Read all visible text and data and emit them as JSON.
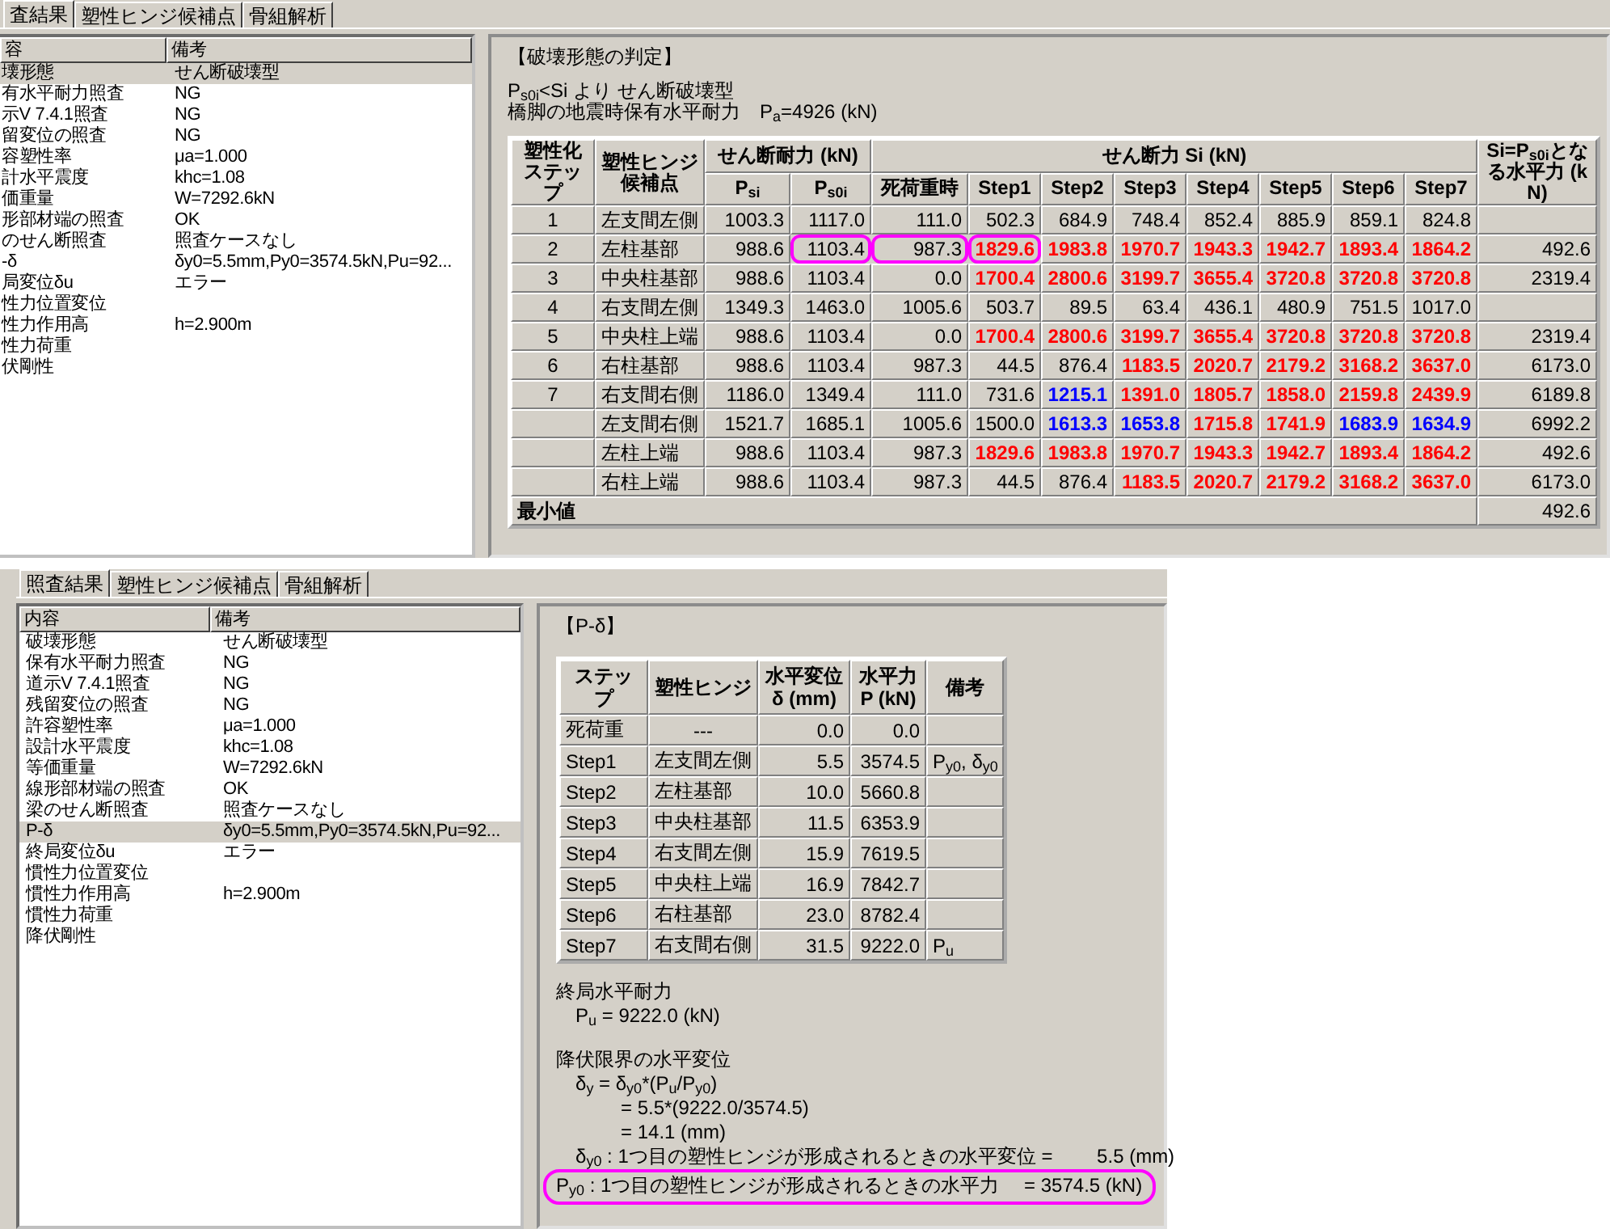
{
  "upper_window": {
    "tabs": [
      {
        "label": "査結果",
        "selected": true
      },
      {
        "label": "塑性ヒンジ候補点",
        "selected": false
      },
      {
        "label": "骨組解析",
        "selected": false
      }
    ],
    "list": {
      "columns": [
        "容",
        "備考"
      ],
      "rows": [
        {
          "label": "壊形態",
          "note": "せん断破壊型",
          "selected": true
        },
        {
          "label": "有水平耐力照査",
          "note": "NG",
          "selected": false
        },
        {
          "label": "示V 7.4.1照査",
          "note": "NG",
          "selected": false
        },
        {
          "label": "留変位の照査",
          "note": "NG",
          "selected": false
        },
        {
          "label": "容塑性率",
          "note": "μa=1.000",
          "selected": false
        },
        {
          "label": "計水平震度",
          "note": "khc=1.08",
          "selected": false
        },
        {
          "label": "価重量",
          "note": "W=7292.6kN",
          "selected": false
        },
        {
          "label": "形部材端の照査",
          "note": "OK",
          "selected": false
        },
        {
          "label": "のせん断照査",
          "note": "照査ケースなし",
          "selected": false
        },
        {
          "label": "-δ",
          "note": "δy0=5.5mm,Py0=3574.5kN,Pu=92...",
          "selected": false
        },
        {
          "label": "局変位δu",
          "note": "エラー",
          "selected": false
        },
        {
          "label": "性力位置変位",
          "selected": false
        },
        {
          "label": "性力作用高",
          "note": "h=2.900m",
          "selected": false
        },
        {
          "label": "性力荷重",
          "selected": false
        },
        {
          "label": "伏剛性",
          "selected": false
        }
      ]
    },
    "panel": {
      "heading": "【破壊形態の判定】",
      "lines": [
        "P$_{s0i}$<Si より せん断破壊型",
        "橋脚の地震時保有水平耐力　P$_{a}$=4926 (kN)"
      ],
      "table": {
        "headers": {
          "step": "塑性化ステップ",
          "hinge": "塑性ヒンジ候補点",
          "capacity": "せん断耐力 (kN)",
          "psi": "P$_{si}$",
          "ps0i": "P$_{s0i}$",
          "force": "せん断力 Si (kN)",
          "force_columns": [
            "死荷重時",
            "Step1",
            "Step2",
            "Step3",
            "Step4",
            "Step5",
            "Step6",
            "Step7"
          ],
          "result": "Si=P$_{s0i}$となる水平力 (kN)"
        },
        "rows": [
          {
            "step": "1",
            "hinge": "左支間左側",
            "cells": [
              {
                "text": "1003.3",
                "kind": "plain",
                "circled": false
              },
              {
                "text": "1117.0",
                "kind": "plain",
                "circled": false
              },
              {
                "text": "111.0",
                "kind": "plain",
                "circled": false
              },
              {
                "text": "502.3",
                "kind": "plain",
                "circled": false
              },
              {
                "text": "684.9",
                "kind": "plain",
                "circled": false
              },
              {
                "text": "748.4",
                "kind": "plain",
                "circled": false
              },
              {
                "text": "852.4",
                "kind": "plain",
                "circled": false
              },
              {
                "text": "885.9",
                "kind": "plain",
                "circled": false
              },
              {
                "text": "859.1",
                "kind": "plain",
                "circled": false
              },
              {
                "text": "824.8",
                "kind": "plain",
                "circled": false
              }
            ]
          },
          {
            "step": "2",
            "hinge": "左柱基部",
            "result": "492.6",
            "cells": [
              {
                "text": "988.6",
                "kind": "plain",
                "circled": false
              },
              {
                "text": "1103.4",
                "kind": "plain",
                "circled": true
              },
              {
                "text": "987.3",
                "kind": "plain",
                "circled": true
              },
              {
                "text": "1829.6",
                "kind": "red",
                "circled": true
              },
              {
                "text": "1983.8",
                "kind": "red",
                "circled": false
              },
              {
                "text": "1970.7",
                "kind": "red",
                "circled": false
              },
              {
                "text": "1943.3",
                "kind": "red",
                "circled": false
              },
              {
                "text": "1942.7",
                "kind": "red",
                "circled": false
              },
              {
                "text": "1893.4",
                "kind": "red",
                "circled": false
              },
              {
                "text": "1864.2",
                "kind": "red",
                "circled": false
              }
            ]
          },
          {
            "step": "3",
            "hinge": "中央柱基部",
            "result": "2319.4",
            "cells": [
              {
                "text": "988.6",
                "kind": "plain",
                "circled": false
              },
              {
                "text": "1103.4",
                "kind": "plain",
                "circled": false
              },
              {
                "text": "0.0",
                "kind": "plain",
                "circled": false
              },
              {
                "text": "1700.4",
                "kind": "red",
                "circled": false
              },
              {
                "text": "2800.6",
                "kind": "red",
                "circled": false
              },
              {
                "text": "3199.7",
                "kind": "red",
                "circled": false
              },
              {
                "text": "3655.4",
                "kind": "red",
                "circled": false
              },
              {
                "text": "3720.8",
                "kind": "red",
                "circled": false
              },
              {
                "text": "3720.8",
                "kind": "red",
                "circled": false
              },
              {
                "text": "3720.8",
                "kind": "red",
                "circled": false
              }
            ]
          },
          {
            "step": "4",
            "hinge": "右支間左側",
            "cells": [
              {
                "text": "1349.3",
                "kind": "plain",
                "circled": false
              },
              {
                "text": "1463.0",
                "kind": "plain",
                "circled": false
              },
              {
                "text": "1005.6",
                "kind": "plain",
                "circled": false
              },
              {
                "text": "503.7",
                "kind": "plain",
                "circled": false
              },
              {
                "text": "89.5",
                "kind": "plain",
                "circled": false
              },
              {
                "text": "63.4",
                "kind": "plain",
                "circled": false
              },
              {
                "text": "436.1",
                "kind": "plain",
                "circled": false
              },
              {
                "text": "480.9",
                "kind": "plain",
                "circled": false
              },
              {
                "text": "751.5",
                "kind": "plain",
                "circled": false
              },
              {
                "text": "1017.0",
                "kind": "plain",
                "circled": false
              }
            ]
          },
          {
            "step": "5",
            "hinge": "中央柱上端",
            "result": "2319.4",
            "cells": [
              {
                "text": "988.6",
                "kind": "plain",
                "circled": false
              },
              {
                "text": "1103.4",
                "kind": "plain",
                "circled": false
              },
              {
                "text": "0.0",
                "kind": "plain",
                "circled": false
              },
              {
                "text": "1700.4",
                "kind": "red",
                "circled": false
              },
              {
                "text": "2800.6",
                "kind": "red",
                "circled": false
              },
              {
                "text": "3199.7",
                "kind": "red",
                "circled": false
              },
              {
                "text": "3655.4",
                "kind": "red",
                "circled": false
              },
              {
                "text": "3720.8",
                "kind": "red",
                "circled": false
              },
              {
                "text": "3720.8",
                "kind": "red",
                "circled": false
              },
              {
                "text": "3720.8",
                "kind": "red",
                "circled": false
              }
            ]
          },
          {
            "step": "6",
            "hinge": "右柱基部",
            "result": "6173.0",
            "cells": [
              {
                "text": "988.6",
                "kind": "plain",
                "circled": false
              },
              {
                "text": "1103.4",
                "kind": "plain",
                "circled": false
              },
              {
                "text": "987.3",
                "kind": "plain",
                "circled": false
              },
              {
                "text": "44.5",
                "kind": "plain",
                "circled": false
              },
              {
                "text": "876.4",
                "kind": "plain",
                "circled": false
              },
              {
                "text": "1183.5",
                "kind": "red",
                "circled": false
              },
              {
                "text": "2020.7",
                "kind": "red",
                "circled": false
              },
              {
                "text": "2179.2",
                "kind": "red",
                "circled": false
              },
              {
                "text": "3168.2",
                "kind": "red",
                "circled": false
              },
              {
                "text": "3637.0",
                "kind": "red",
                "circled": false
              }
            ]
          },
          {
            "step": "7",
            "hinge": "右支間右側",
            "result": "6189.8",
            "cells": [
              {
                "text": "1186.0",
                "kind": "plain",
                "circled": false
              },
              {
                "text": "1349.4",
                "kind": "plain",
                "circled": false
              },
              {
                "text": "111.0",
                "kind": "plain",
                "circled": false
              },
              {
                "text": "731.6",
                "kind": "plain",
                "circled": false
              },
              {
                "text": "1215.1",
                "kind": "blue",
                "circled": false
              },
              {
                "text": "1391.0",
                "kind": "red",
                "circled": false
              },
              {
                "text": "1805.7",
                "kind": "red",
                "circled": false
              },
              {
                "text": "1858.0",
                "kind": "red",
                "circled": false
              },
              {
                "text": "2159.8",
                "kind": "red",
                "circled": false
              },
              {
                "text": "2439.9",
                "kind": "red",
                "circled": false
              }
            ]
          },
          {
            "hinge": "左支間右側",
            "result": "6992.2",
            "cells": [
              {
                "text": "1521.7",
                "kind": "plain",
                "circled": false
              },
              {
                "text": "1685.1",
                "kind": "plain",
                "circled": false
              },
              {
                "text": "1005.6",
                "kind": "plain",
                "circled": false
              },
              {
                "text": "1500.0",
                "kind": "plain",
                "circled": false
              },
              {
                "text": "1613.3",
                "kind": "blue",
                "circled": false
              },
              {
                "text": "1653.8",
                "kind": "blue",
                "circled": false
              },
              {
                "text": "1715.8",
                "kind": "red",
                "circled": false
              },
              {
                "text": "1741.9",
                "kind": "red",
                "circled": false
              },
              {
                "text": "1683.9",
                "kind": "blue",
                "circled": false
              },
              {
                "text": "1634.9",
                "kind": "blue",
                "circled": false
              }
            ]
          },
          {
            "hinge": "左柱上端",
            "result": "492.6",
            "cells": [
              {
                "text": "988.6",
                "kind": "plain",
                "circled": false
              },
              {
                "text": "1103.4",
                "kind": "plain",
                "circled": false
              },
              {
                "text": "987.3",
                "kind": "plain",
                "circled": false
              },
              {
                "text": "1829.6",
                "kind": "red",
                "circled": false
              },
              {
                "text": "1983.8",
                "kind": "red",
                "circled": false
              },
              {
                "text": "1970.7",
                "kind": "red",
                "circled": false
              },
              {
                "text": "1943.3",
                "kind": "red",
                "circled": false
              },
              {
                "text": "1942.7",
                "kind": "red",
                "circled": false
              },
              {
                "text": "1893.4",
                "kind": "red",
                "circled": false
              },
              {
                "text": "1864.2",
                "kind": "red",
                "circled": false
              }
            ]
          },
          {
            "hinge": "右柱上端",
            "result": "6173.0",
            "cells": [
              {
                "text": "988.6",
                "kind": "plain",
                "circled": false
              },
              {
                "text": "1103.4",
                "kind": "plain",
                "circled": false
              },
              {
                "text": "987.3",
                "kind": "plain",
                "circled": false
              },
              {
                "text": "44.5",
                "kind": "plain",
                "circled": false
              },
              {
                "text": "876.4",
                "kind": "plain",
                "circled": false
              },
              {
                "text": "1183.5",
                "kind": "red",
                "circled": false
              },
              {
                "text": "2020.7",
                "kind": "red",
                "circled": false
              },
              {
                "text": "2179.2",
                "kind": "red",
                "circled": false
              },
              {
                "text": "3168.2",
                "kind": "red",
                "circled": false
              },
              {
                "text": "3637.0",
                "kind": "red",
                "circled": false
              }
            ]
          }
        ],
        "minimum": {
          "label": "最小値",
          "value": "492.6"
        }
      }
    }
  },
  "lower_window": {
    "tabs": [
      {
        "label": "照査結果",
        "selected": true
      },
      {
        "label": "塑性ヒンジ候補点",
        "selected": false
      },
      {
        "label": "骨組解析",
        "selected": false
      }
    ],
    "list": {
      "columns": [
        "内容",
        "備考"
      ],
      "rows": [
        {
          "label": "破壊形態",
          "note": "せん断破壊型",
          "selected": false
        },
        {
          "label": "保有水平耐力照査",
          "note": "NG",
          "selected": false
        },
        {
          "label": "道示V 7.4.1照査",
          "note": "NG",
          "selected": false
        },
        {
          "label": "残留変位の照査",
          "note": "NG",
          "selected": false
        },
        {
          "label": "許容塑性率",
          "note": "μa=1.000",
          "selected": false
        },
        {
          "label": "設計水平震度",
          "note": "khc=1.08",
          "selected": false
        },
        {
          "label": "等価重量",
          "note": "W=7292.6kN",
          "selected": false
        },
        {
          "label": "線形部材端の照査",
          "note": "OK",
          "selected": false
        },
        {
          "label": "梁のせん断照査",
          "note": "照査ケースなし",
          "selected": false
        },
        {
          "label": "P-δ",
          "note": "δy0=5.5mm,Py0=3574.5kN,Pu=92...",
          "selected": true
        },
        {
          "label": "終局変位δu",
          "note": "エラー",
          "selected": false
        },
        {
          "label": "慣性力位置変位",
          "selected": false
        },
        {
          "label": "慣性力作用高",
          "note": "h=2.900m",
          "selected": false
        },
        {
          "label": "慣性力荷重",
          "selected": false
        },
        {
          "label": "降伏剛性",
          "selected": false
        }
      ]
    },
    "panel": {
      "heading": "【P-δ】",
      "table": {
        "columns": [
          "ステップ",
          "塑性ヒンジ",
          "水平変位\nδ (mm)",
          "水平力\nP (kN)",
          "備考"
        ],
        "rows": [
          {
            "step": "死荷重",
            "hinge": "---",
            "displacement": "0.0",
            "force": "0.0"
          },
          {
            "step": "Step1",
            "hinge": "左支間左側",
            "displacement": "5.5",
            "force": "3574.5",
            "remark": "P$_{y0}$, δ$_{y0}$"
          },
          {
            "step": "Step2",
            "hinge": "左柱基部",
            "displacement": "10.0",
            "force": "5660.8"
          },
          {
            "step": "Step3",
            "hinge": "中央柱基部",
            "displacement": "11.5",
            "force": "6353.9"
          },
          {
            "step": "Step4",
            "hinge": "右支間左側",
            "displacement": "15.9",
            "force": "7619.5"
          },
          {
            "step": "Step5",
            "hinge": "中央柱上端",
            "displacement": "16.9",
            "force": "7842.7"
          },
          {
            "step": "Step6",
            "hinge": "右柱基部",
            "displacement": "23.0",
            "force": "8782.4"
          },
          {
            "step": "Step7",
            "hinge": "右支間右側",
            "displacement": "31.5",
            "force": "9222.0",
            "remark": "P$_{u}$"
          }
        ]
      },
      "notes": [
        {
          "kind": "heading",
          "text": "終局水平耐力",
          "circled": false
        },
        {
          "kind": "value",
          "text": "P$_{u}$ = 9222.0 (kN)",
          "circled": false
        },
        {
          "kind": "heading",
          "text": "降伏限界の水平変位",
          "circled": false
        },
        {
          "kind": "formula",
          "text": "δ$_{y}$  = δ$_{y0}$*(P$_{u}$/P$_{y0}$)",
          "circled": false
        },
        {
          "kind": "continuation",
          "text": "= 5.5*(9222.0/3574.5)",
          "circled": false
        },
        {
          "kind": "continuation",
          "text": "= 14.1 (mm)",
          "circled": false
        },
        {
          "kind": "formula",
          "text": "δ$_{y0}$ : 1つ目の塑性ヒンジが形成されるときの水平変位 =　　 5.5 (mm)",
          "circled": false
        },
        {
          "kind": "formula",
          "text": "P$_{y0}$ : 1つ目の塑性ヒンジが形成されるときの水平力　 = 3574.5 (kN)",
          "circled": true
        }
      ]
    }
  }
}
